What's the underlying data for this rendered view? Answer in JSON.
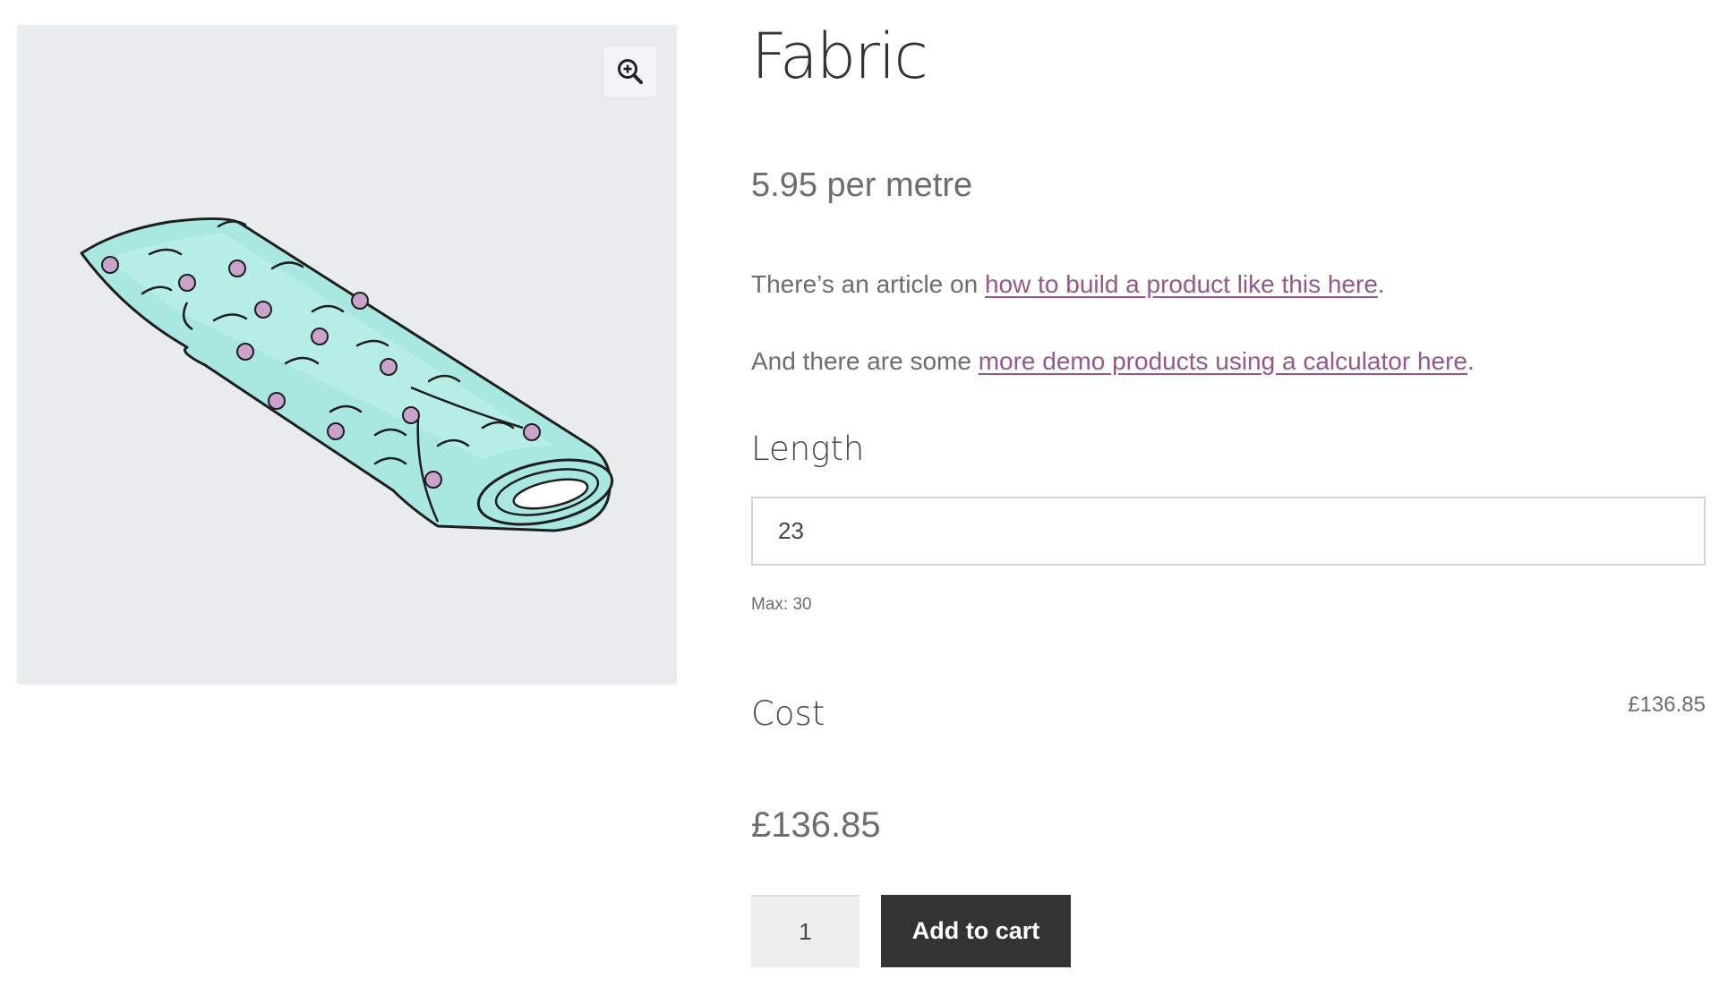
{
  "product": {
    "title": "Fabric",
    "price_per_unit": "5.95 per metre",
    "description": {
      "line1_prefix": "There’s an article on ",
      "line1_link": "how to build a product like this here",
      "line1_suffix": ".",
      "line2_prefix": "And there are some ",
      "line2_link": "more demo products using a calculator here",
      "line2_suffix": "."
    }
  },
  "gallery": {
    "zoom_icon": "zoom-in-icon",
    "image": "fabric-roll-illustration",
    "background_color": "#e9ecef",
    "fabric_color": "#a8e8e0",
    "flower_color": "#c9a3c9"
  },
  "calculator": {
    "length_label": "Length",
    "length_value": "23",
    "max_note": "Max: 30",
    "cost_label": "Cost",
    "cost_value": "£136.85"
  },
  "total_price": "£136.85",
  "cart": {
    "quantity": "1",
    "add_to_cart_label": "Add to cart"
  },
  "colors": {
    "link": "#96588a",
    "button_bg": "#333333",
    "text": "#43454b"
  }
}
